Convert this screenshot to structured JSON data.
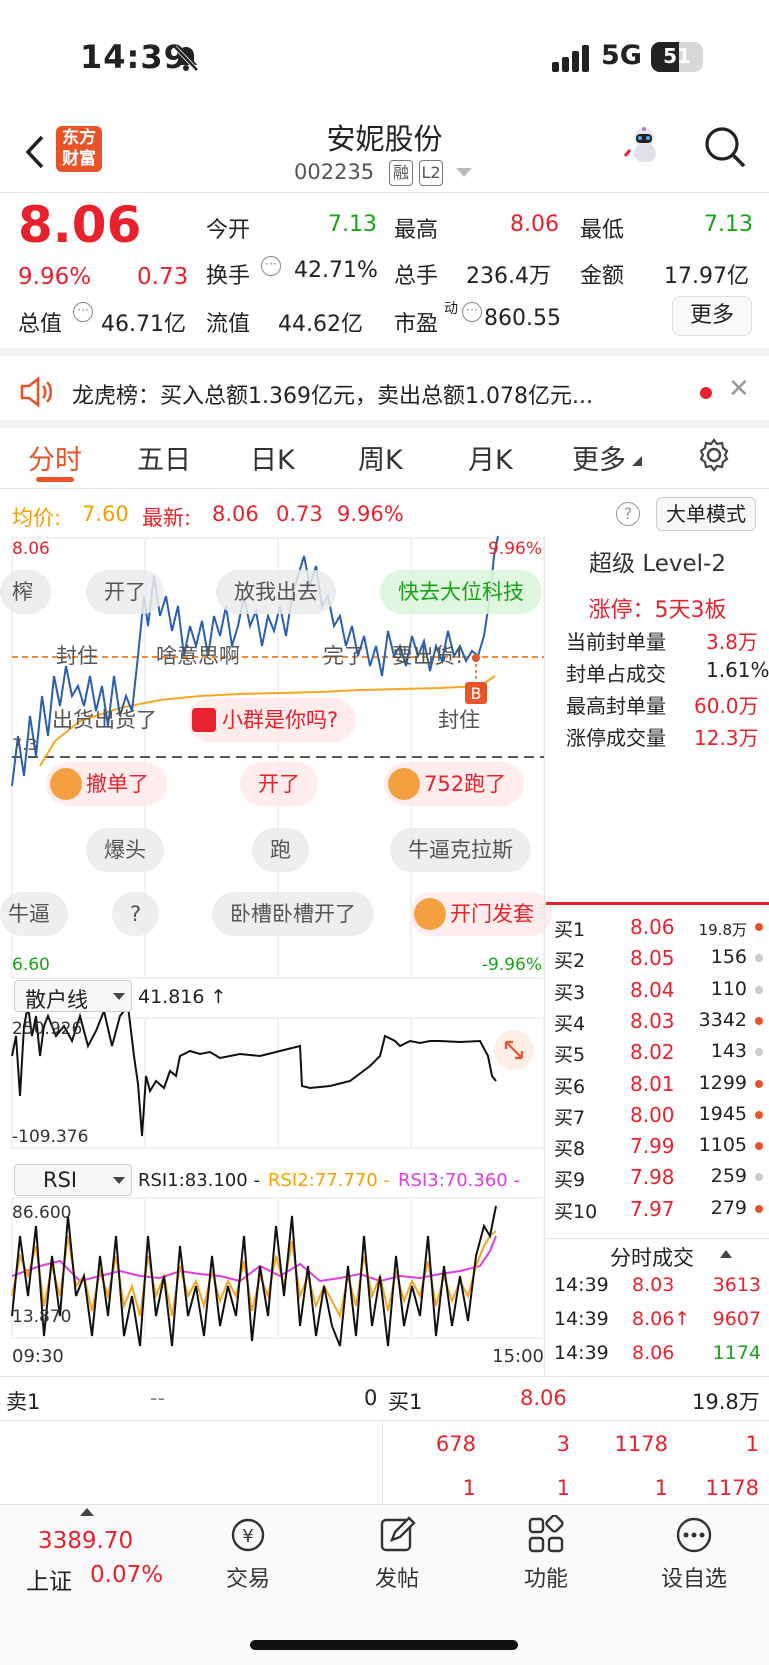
{
  "status_bar": {
    "time": "14:39",
    "network": "5G",
    "battery": "51"
  },
  "header": {
    "title": "安妮股份",
    "code": "002235",
    "badge1": "融",
    "badge2": "L2",
    "logo_line1": "东方",
    "logo_line2": "财富"
  },
  "quote": {
    "price": "8.06",
    "change_pct": "9.96%",
    "change": "0.73",
    "open_label": "今开",
    "open": "7.13",
    "high_label": "最高",
    "high": "8.06",
    "low_label": "最低",
    "low": "7.13",
    "turnover_label": "换手",
    "turnover": "42.71%",
    "volume_label": "总手",
    "volume": "236.4万",
    "amount_label": "金额",
    "amount": "17.97亿",
    "mcap_label": "总值",
    "mcap": "46.71亿",
    "float_label": "流值",
    "float": "44.62亿",
    "pe_label": "市盈",
    "pe_sup": "动",
    "pe": "860.55",
    "more": "更多"
  },
  "news": {
    "text": "龙虎榜：买入总额1.369亿元，卖出总额1.078亿元..."
  },
  "tabs": [
    "分时",
    "五日",
    "日K",
    "周K",
    "月K",
    "更多"
  ],
  "chart_header": {
    "avg_label": "均价:",
    "avg": "7.60",
    "latest_label": "最新:",
    "latest": "8.06",
    "chg": "0.73",
    "pct": "9.96%",
    "mode_btn": "大单模式"
  },
  "chart": {
    "ymax": "8.06",
    "ymax_pct": "9.96%",
    "ymin": "6.60",
    "ymin_pct": "-9.96%",
    "mid": "7.3",
    "b_marker": "B",
    "time_start": "09:30",
    "time_end": "15:00"
  },
  "danmu": [
    "榨",
    "开了",
    "放我出去",
    "快去大位科技",
    "封住",
    "啥意思啊",
    "完了",
    "要出货!",
    "出货出货了",
    "小群是你吗?",
    "封住",
    "撤单了",
    "开了",
    "752跑了",
    "爆头",
    "跑",
    "牛逼克拉斯",
    "牛逼",
    "?",
    "卧槽卧槽开了",
    "开门发套"
  ],
  "sub1": {
    "name": "散户线",
    "value": "41.816 ↑",
    "top": "250.926",
    "bottom": "-109.376"
  },
  "sub2": {
    "name": "RSI",
    "rsi1": "RSI1:83.100 -",
    "rsi2": "RSI2:77.770 -",
    "rsi3": "RSI3:70.360 -",
    "top": "86.600",
    "bottom": "13.870"
  },
  "level2": {
    "title": "超级 Level-2",
    "limit": "涨停：5天3板",
    "rows": [
      {
        "label": "当前封单量",
        "value": "3.8万"
      },
      {
        "label": "封单占成交",
        "value": "1.61%"
      },
      {
        "label": "最高封单量",
        "value": "60.0万"
      },
      {
        "label": "涨停成交量",
        "value": "12.3万"
      }
    ]
  },
  "bids": [
    {
      "label": "买1",
      "price": "8.06",
      "vol": "19.8万"
    },
    {
      "label": "买2",
      "price": "8.05",
      "vol": "156"
    },
    {
      "label": "买3",
      "price": "8.04",
      "vol": "110"
    },
    {
      "label": "买4",
      "price": "8.03",
      "vol": "3342"
    },
    {
      "label": "买5",
      "price": "8.02",
      "vol": "143"
    },
    {
      "label": "买6",
      "price": "8.01",
      "vol": "1299"
    },
    {
      "label": "买7",
      "price": "8.00",
      "vol": "1945"
    },
    {
      "label": "买8",
      "price": "7.99",
      "vol": "1105"
    },
    {
      "label": "买9",
      "price": "7.98",
      "vol": "259"
    },
    {
      "label": "买10",
      "price": "7.97",
      "vol": "279"
    }
  ],
  "ticks": {
    "title": "分时成交",
    "rows": [
      {
        "time": "14:39",
        "price": "8.03",
        "vol": "3613"
      },
      {
        "time": "14:39",
        "price": "8.06↑",
        "vol": "9607"
      },
      {
        "time": "14:39",
        "price": "8.06",
        "vol": "1174"
      }
    ]
  },
  "bottom_quote": {
    "sell_label": "卖1",
    "sell_price": "--",
    "sell_vol": "0",
    "buy_label": "买1",
    "buy_price": "8.06",
    "buy_vol": "19.8万",
    "row2": [
      "678",
      "3",
      "1178",
      "1"
    ],
    "row3": [
      "1",
      "1",
      "1",
      "1178"
    ]
  },
  "nav": {
    "index_value": "3389.70",
    "index_name": "上证",
    "index_pct": "0.07%",
    "items": [
      "交易",
      "发帖",
      "功能",
      "设自选"
    ]
  }
}
